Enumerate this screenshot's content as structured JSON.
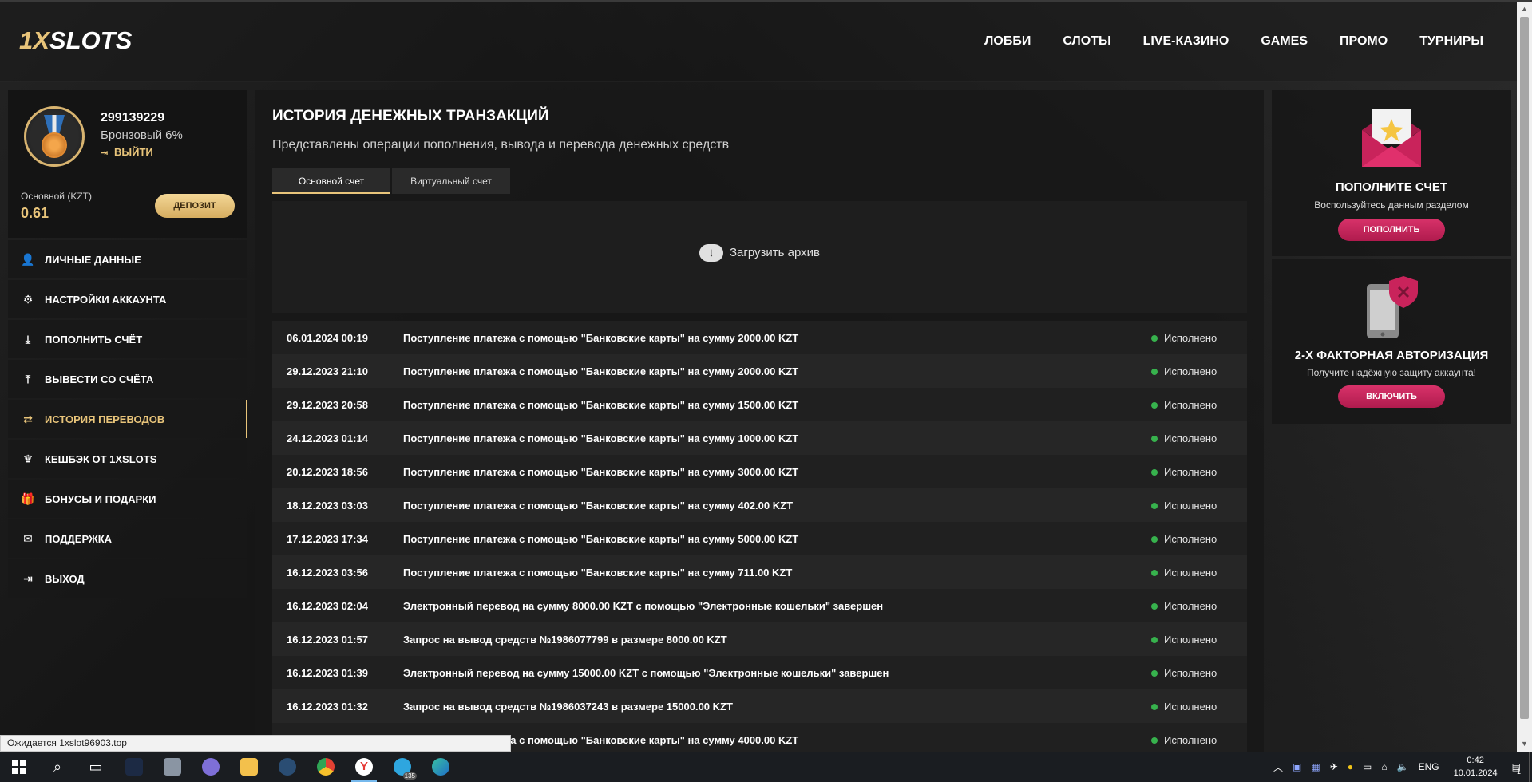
{
  "header": {
    "logo_main": "1X",
    "logo_rest": "SLOTS",
    "nav": [
      "ЛОББИ",
      "СЛОТЫ",
      "LIVE-КАЗИНО",
      "GAMES",
      "ПРОМО",
      "ТУРНИРЫ"
    ]
  },
  "profile": {
    "user_id": "299139229",
    "level": "Бронзовый 6%",
    "logout_label": "ВЫЙТИ",
    "account_label": "Основной (KZT)",
    "balance": "0.61",
    "deposit_label": "ДЕПОЗИТ"
  },
  "menu": [
    {
      "label": "ЛИЧНЫЕ ДАННЫЕ",
      "icon": "user-plus-icon"
    },
    {
      "label": "НАСТРОЙКИ АККАУНТА",
      "icon": "gears-icon"
    },
    {
      "label": "ПОПОЛНИТЬ СЧЁТ",
      "icon": "download-icon"
    },
    {
      "label": "ВЫВЕСТИ СО СЧЁТА",
      "icon": "upload-icon"
    },
    {
      "label": "ИСТОРИЯ ПЕРЕВОДОВ",
      "icon": "exchange-icon",
      "active": true
    },
    {
      "label": "КЕШБЭК ОТ 1XSLOTS",
      "icon": "crown-icon"
    },
    {
      "label": "БОНУСЫ И ПОДАРКИ",
      "icon": "gift-icon"
    },
    {
      "label": "ПОДДЕРЖКА",
      "icon": "envelope-icon"
    },
    {
      "label": "ВЫХОД",
      "icon": "sign-out-icon"
    }
  ],
  "main": {
    "title": "ИСТОРИЯ ДЕНЕЖНЫХ ТРАНЗАКЦИЙ",
    "subtitle": "Представлены операции пополнения, вывода и перевода денежных средств",
    "tabs": [
      "Основной счет",
      "Виртуальный счет"
    ],
    "archive_label": "Загрузить архив",
    "transactions": [
      {
        "date": "06.01.2024 00:19",
        "desc": "Поступление платежа с помощью \"Банковские карты\" на сумму 2000.00 KZT",
        "status": "Исполнено"
      },
      {
        "date": "29.12.2023 21:10",
        "desc": "Поступление платежа с помощью \"Банковские карты\" на сумму 2000.00 KZT",
        "status": "Исполнено"
      },
      {
        "date": "29.12.2023 20:58",
        "desc": "Поступление платежа с помощью \"Банковские карты\" на сумму 1500.00 KZT",
        "status": "Исполнено"
      },
      {
        "date": "24.12.2023 01:14",
        "desc": "Поступление платежа с помощью \"Банковские карты\" на сумму 1000.00 KZT",
        "status": "Исполнено"
      },
      {
        "date": "20.12.2023 18:56",
        "desc": "Поступление платежа с помощью \"Банковские карты\" на сумму 3000.00 KZT",
        "status": "Исполнено"
      },
      {
        "date": "18.12.2023 03:03",
        "desc": "Поступление платежа с помощью \"Банковские карты\" на сумму 402.00 KZT",
        "status": "Исполнено"
      },
      {
        "date": "17.12.2023 17:34",
        "desc": "Поступление платежа с помощью \"Банковские карты\" на сумму 5000.00 KZT",
        "status": "Исполнено"
      },
      {
        "date": "16.12.2023 03:56",
        "desc": "Поступление платежа с помощью \"Банковские карты\" на сумму 711.00 KZT",
        "status": "Исполнено"
      },
      {
        "date": "16.12.2023 02:04",
        "desc": "Электронный перевод на сумму 8000.00 KZT с помощью \"Электронные кошельки\" завершен",
        "status": "Исполнено"
      },
      {
        "date": "16.12.2023 01:57",
        "desc": "Запрос на вывод средств №1986077799 в размере 8000.00 KZT",
        "status": "Исполнено"
      },
      {
        "date": "16.12.2023 01:39",
        "desc": "Электронный перевод на сумму 15000.00 KZT с помощью \"Электронные кошельки\" завершен",
        "status": "Исполнено"
      },
      {
        "date": "16.12.2023 01:32",
        "desc": "Запрос на вывод средств №1986037243 в размере 15000.00 KZT",
        "status": "Исполнено"
      },
      {
        "date": "",
        "desc": "Поступление платежа с помощью \"Банковские карты\" на сумму 4000.00 KZT",
        "status": "Исполнено"
      }
    ]
  },
  "cards": {
    "topup": {
      "title": "ПОПОЛНИТЕ СЧЕТ",
      "desc": "Воспользуйтесь данным разделом",
      "button": "ПОПОЛНИТЬ"
    },
    "twofa": {
      "title": "2-Х ФАКТОРНАЯ АВТОРИЗАЦИЯ",
      "desc": "Получите надёжную защиту аккаунта!",
      "button": "ВКЛЮЧИТЬ"
    }
  },
  "status_url": "Ожидается 1xslot96903.top",
  "taskbar": {
    "language": "ENG",
    "time": "0:42",
    "date": "10.01.2024",
    "notifications": "1",
    "telegram_badge": "135"
  },
  "colors": {
    "accent": "#e8c47a",
    "brand_pink": "#c9235b",
    "status_ok": "#37b24d"
  }
}
